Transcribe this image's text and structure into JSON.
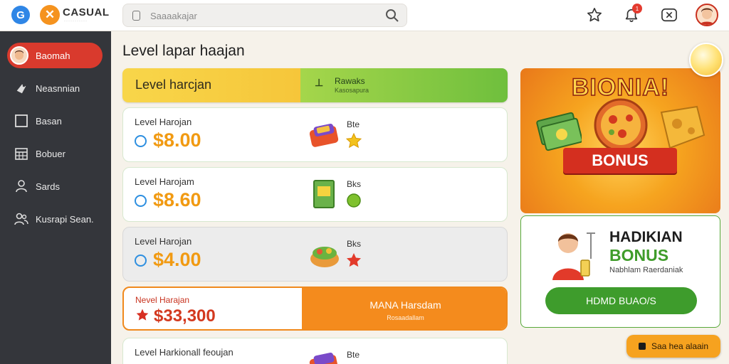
{
  "brand": {
    "g_letter": "G",
    "x_letter": "✕",
    "name": "CASUAL",
    "sub": "···········"
  },
  "search": {
    "placeholder": "Saaaakajar"
  },
  "topbar": {
    "notification_count": "1"
  },
  "sidebar": {
    "items": [
      {
        "label": "Baomah",
        "icon": "avatar",
        "active": true
      },
      {
        "label": "Neasnnian",
        "icon": "controller-icon"
      },
      {
        "label": "Basan",
        "icon": "square-icon"
      },
      {
        "label": "Bobuer",
        "icon": "calendar-icon"
      },
      {
        "label": "Sards",
        "icon": "user-icon"
      },
      {
        "label": "Kusrapi Sean.",
        "icon": "users-icon"
      }
    ]
  },
  "main": {
    "title": "Level lapar haajan",
    "hero": {
      "left": "Level harcjan",
      "mark": "⊥",
      "right_title": "Rawaks",
      "right_sub": "Kasosapura"
    },
    "cards": [
      {
        "label": "Level Harojan",
        "price": "$8.00",
        "tag": "Bte",
        "style": "white"
      },
      {
        "label": "Level Harojam",
        "price": "$8.60",
        "tag": "Bks",
        "style": "white"
      },
      {
        "label": "Level Harojan",
        "price": "$4.00",
        "tag": "Bks",
        "style": "gray"
      },
      {
        "label": "Nevel Harajan",
        "price": "$33,300",
        "tag": "",
        "style": "highlight",
        "cta_title": "MANA Harsdam",
        "cta_sub": "Rosaadallam"
      },
      {
        "label": "Level Harkionall feoujan",
        "price": "",
        "tag": "Bte",
        "style": "white"
      }
    ]
  },
  "promo": {
    "title": "BIONIA!",
    "ribbon": "BONUS"
  },
  "bonus_card": {
    "title": "HADIKIAN",
    "subtitle": "BONUS",
    "desc": "Nabhlam Raerdaniak",
    "button": "HDMD BUAO/S"
  },
  "float_button": {
    "label": "Saa hea alaain"
  },
  "colors": {
    "accent_red": "#d93a2d",
    "accent_orange": "#f48b1d",
    "accent_green": "#3e9c2c",
    "sidebar_bg": "#34363b"
  }
}
